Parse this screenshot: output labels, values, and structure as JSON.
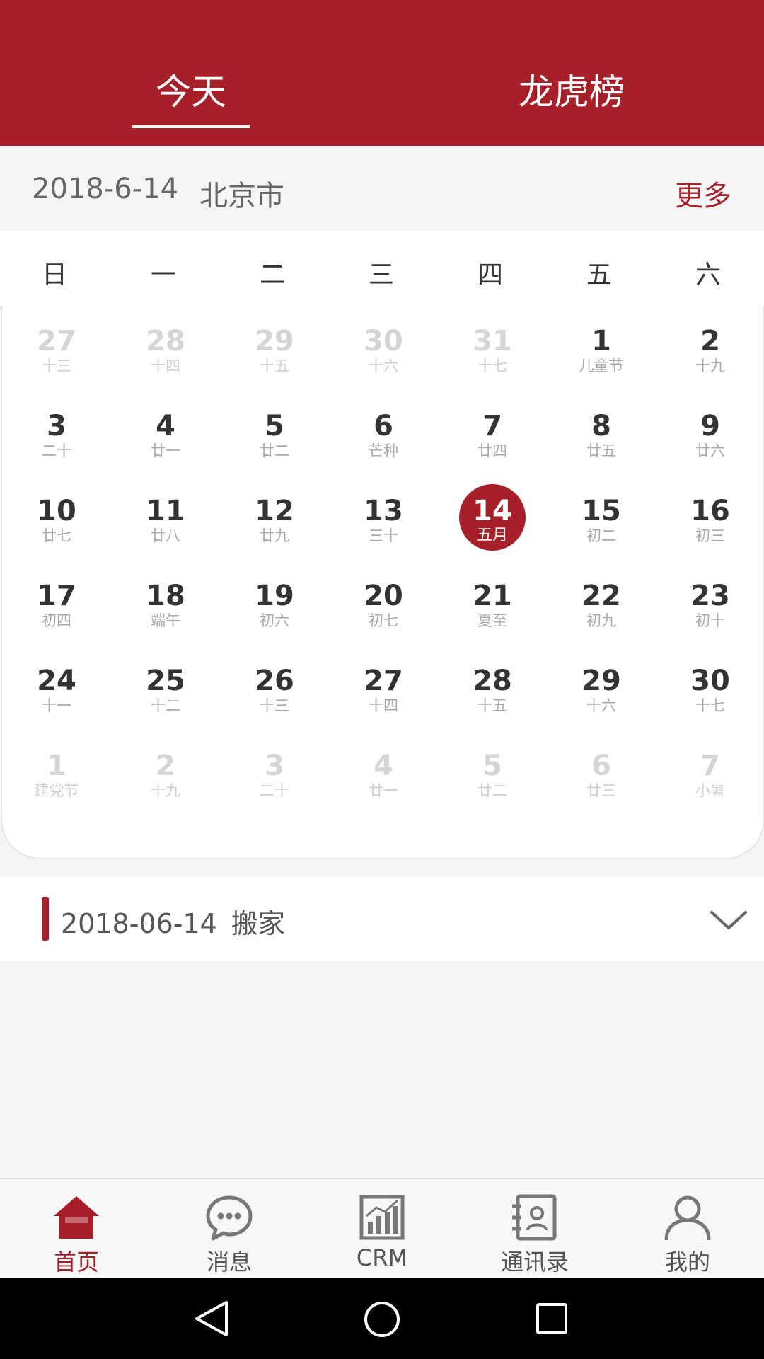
{
  "header": {
    "tabs": [
      {
        "label": "今天",
        "active": true
      },
      {
        "label": "龙虎榜",
        "active": false
      }
    ]
  },
  "info": {
    "date": "2018-6-14",
    "city": "北京市",
    "more": "更多"
  },
  "weekdays": [
    "日",
    "一",
    "二",
    "三",
    "四",
    "五",
    "六"
  ],
  "calendar": {
    "selected_day": 14,
    "weeks": [
      [
        {
          "d": "27",
          "l": "十三",
          "o": true
        },
        {
          "d": "28",
          "l": "十四",
          "o": true
        },
        {
          "d": "29",
          "l": "十五",
          "o": true
        },
        {
          "d": "30",
          "l": "十六",
          "o": true
        },
        {
          "d": "31",
          "l": "十七",
          "o": true
        },
        {
          "d": "1",
          "l": "儿童节"
        },
        {
          "d": "2",
          "l": "十九"
        }
      ],
      [
        {
          "d": "3",
          "l": "二十"
        },
        {
          "d": "4",
          "l": "廿一"
        },
        {
          "d": "5",
          "l": "廿二"
        },
        {
          "d": "6",
          "l": "芒种"
        },
        {
          "d": "7",
          "l": "廿四"
        },
        {
          "d": "8",
          "l": "廿五"
        },
        {
          "d": "9",
          "l": "廿六"
        }
      ],
      [
        {
          "d": "10",
          "l": "廿七"
        },
        {
          "d": "11",
          "l": "廿八"
        },
        {
          "d": "12",
          "l": "廿九"
        },
        {
          "d": "13",
          "l": "三十"
        },
        {
          "d": "14",
          "l": "五月",
          "s": true
        },
        {
          "d": "15",
          "l": "初二"
        },
        {
          "d": "16",
          "l": "初三"
        }
      ],
      [
        {
          "d": "17",
          "l": "初四"
        },
        {
          "d": "18",
          "l": "端午"
        },
        {
          "d": "19",
          "l": "初六"
        },
        {
          "d": "20",
          "l": "初七"
        },
        {
          "d": "21",
          "l": "夏至"
        },
        {
          "d": "22",
          "l": "初九"
        },
        {
          "d": "23",
          "l": "初十"
        }
      ],
      [
        {
          "d": "24",
          "l": "十一"
        },
        {
          "d": "25",
          "l": "十二"
        },
        {
          "d": "26",
          "l": "十三"
        },
        {
          "d": "27",
          "l": "十四"
        },
        {
          "d": "28",
          "l": "十五"
        },
        {
          "d": "29",
          "l": "十六"
        },
        {
          "d": "30",
          "l": "十七"
        }
      ],
      [
        {
          "d": "1",
          "l": "建党节",
          "o": true
        },
        {
          "d": "2",
          "l": "十九",
          "o": true
        },
        {
          "d": "3",
          "l": "二十",
          "o": true
        },
        {
          "d": "4",
          "l": "廿一",
          "o": true
        },
        {
          "d": "5",
          "l": "廿二",
          "o": true
        },
        {
          "d": "6",
          "l": "廿三",
          "o": true
        },
        {
          "d": "7",
          "l": "小暑",
          "o": true
        }
      ]
    ]
  },
  "event": {
    "date": "2018-06-14",
    "title": "搬家"
  },
  "bottom_nav": [
    {
      "label": "首页",
      "icon": "home-icon",
      "active": true
    },
    {
      "label": "消息",
      "icon": "message-icon",
      "active": false
    },
    {
      "label": "CRM",
      "icon": "chart-icon",
      "active": false
    },
    {
      "label": "通讯录",
      "icon": "contacts-icon",
      "active": false
    },
    {
      "label": "我的",
      "icon": "user-icon",
      "active": false
    }
  ],
  "system_nav": [
    "back-icon",
    "home-circle-icon",
    "recents-icon"
  ],
  "colors": {
    "accent": "#a61f29",
    "text": "#333333",
    "muted": "#aaaaaa"
  }
}
